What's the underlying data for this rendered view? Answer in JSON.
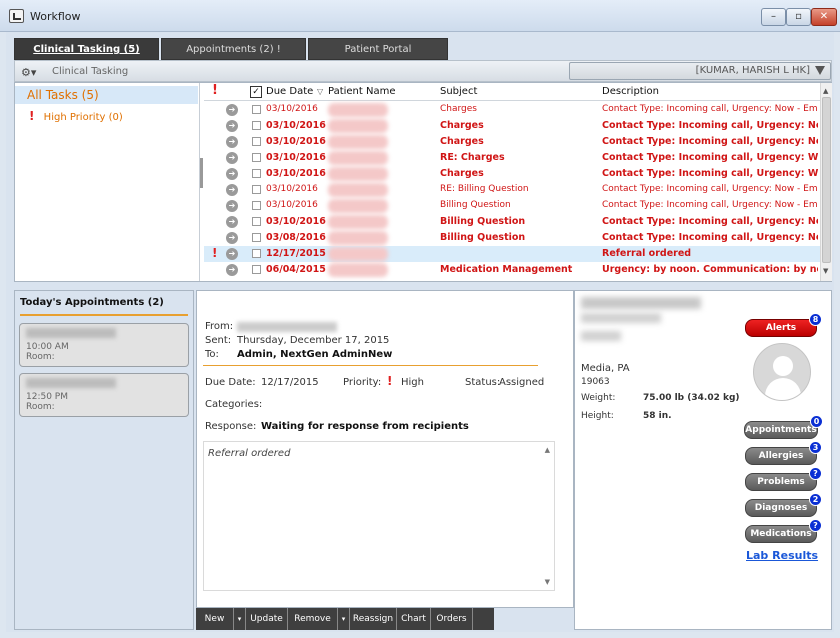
{
  "window": {
    "title": "Workflow",
    "min": "–",
    "max": "▫",
    "close": "✕"
  },
  "tabs": [
    {
      "label": "Clinical Tasking (5)"
    },
    {
      "label": "Appointments (2) !"
    },
    {
      "label": "Patient Portal"
    }
  ],
  "toolbar": {
    "title": "Clinical Tasking",
    "gear_icon": "gear-icon",
    "user": "[KUMAR, HARISH L HK]"
  },
  "tree": {
    "all": "All Tasks (5)",
    "high": "High Priority (0)"
  },
  "grid": {
    "headers": {
      "due": "Due Date",
      "patient": "Patient Name",
      "subject": "Subject",
      "description": "Description"
    },
    "rows": [
      {
        "date": "03/10/2016",
        "subject": "Charges",
        "desc": "Contact Type: Incoming call, Urgency: Now - Em...",
        "style": "light",
        "bang": ""
      },
      {
        "date": "03/10/2016",
        "subject": "Charges",
        "desc": "Contact Type: Incoming call, Urgency: Now -...",
        "style": "bold",
        "bang": ""
      },
      {
        "date": "03/10/2016",
        "subject": "Charges",
        "desc": "Contact Type: Incoming call, Urgency: Now -...",
        "style": "bold",
        "bang": ""
      },
      {
        "date": "03/10/2016",
        "subject": "RE: Charges",
        "desc": "Contact Type: Incoming call, Urgency: Withi...",
        "style": "bold",
        "bang": ""
      },
      {
        "date": "03/10/2016",
        "subject": "Charges",
        "desc": "Contact Type: Incoming call, Urgency: Withi...",
        "style": "bold",
        "bang": ""
      },
      {
        "date": "03/10/2016",
        "subject": "RE: Billing Question",
        "desc": "Contact Type: Incoming call, Urgency: Now - Em...",
        "style": "light",
        "bang": ""
      },
      {
        "date": "03/10/2016",
        "subject": "Billing Question",
        "desc": "Contact Type: Incoming call, Urgency: Now - Em...",
        "style": "light",
        "bang": ""
      },
      {
        "date": "03/10/2016",
        "subject": "Billing Question",
        "desc": "Contact Type: Incoming call, Urgency: Now -...",
        "style": "bold",
        "bang": ""
      },
      {
        "date": "03/08/2016",
        "subject": "Billing Question",
        "desc": "Contact Type: Incoming call, Urgency: Now -...",
        "style": "bold",
        "bang": ""
      },
      {
        "date": "12/17/2015",
        "subject": "",
        "desc": "Referral ordered",
        "style": "bold sel",
        "bang": "!"
      },
      {
        "date": "06/04/2015",
        "subject": "Medication Management",
        "desc": "Urgency: by noon. Communication: by noon",
        "style": "bold",
        "bang": ""
      }
    ]
  },
  "appointments": {
    "title": "Today's Appointments (2)",
    "items": [
      {
        "time": "10:00 AM",
        "room": "Room:"
      },
      {
        "time": "12:50 PM",
        "room": "Room:"
      }
    ]
  },
  "detail": {
    "from_label": "From:",
    "sent_label": "Sent:",
    "sent": "Thursday, December 17, 2015",
    "to_label": "To:",
    "to": "Admin, NextGen AdminNew",
    "due_label": "Due Date:",
    "due": "12/17/2015",
    "priority_label": "Priority:",
    "priority": "High",
    "status_label": "Status:",
    "status": "Assigned",
    "categories_label": "Categories:",
    "response_label": "Response:",
    "response": "Waiting for response from recipients",
    "body": "Referral ordered"
  },
  "actions": {
    "new": "New",
    "update": "Update",
    "remove": "Remove",
    "reassign": "Reassign",
    "chart": "Chart",
    "orders": "Orders",
    "dd": "▾"
  },
  "patient": {
    "city": "Media, PA",
    "zip": "19063",
    "weight_label": "Weight:",
    "weight": "75.00 lb (34.02 kg)",
    "height_label": "Height:",
    "height": "58 in.",
    "buttons": [
      {
        "label": "Alerts",
        "badge": "8"
      },
      {
        "label": "Appointments",
        "badge": "0"
      },
      {
        "label": "Allergies",
        "badge": "3"
      },
      {
        "label": "Problems",
        "badge": "?"
      },
      {
        "label": "Diagnoses",
        "badge": "2"
      },
      {
        "label": "Medications",
        "badge": "?"
      }
    ],
    "lab_results": "Lab Results"
  }
}
